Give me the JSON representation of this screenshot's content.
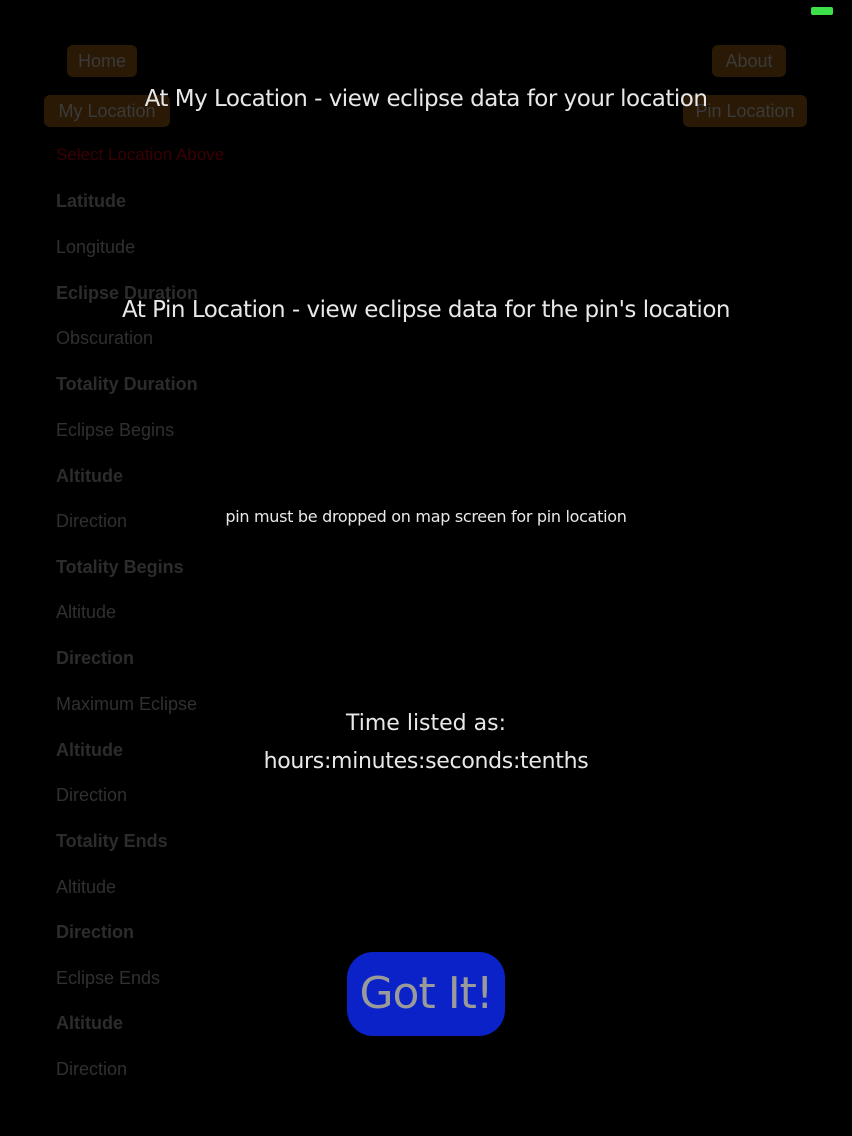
{
  "status_bar": {
    "battery_color": "#3ee04a"
  },
  "nav": {
    "home_label": "Home",
    "about_label": "About",
    "my_location_label": "My Location",
    "pin_location_label": "Pin Location"
  },
  "list": {
    "select_prompt": "Select Location Above",
    "items": [
      "Latitude",
      "Longitude",
      "Eclipse Duration",
      "Obscuration",
      "Totality Duration",
      "Eclipse Begins",
      "Altitude",
      "Direction",
      "Totality Begins",
      "Altitude",
      "Direction",
      "Maximum Eclipse",
      "Altitude",
      "Direction",
      "Totality Ends",
      "Altitude",
      "Direction",
      "Eclipse Ends",
      "Altitude",
      "Direction"
    ]
  },
  "overlay": {
    "my_location_help": "At My Location - view eclipse data for your location",
    "pin_location_help": "At Pin Location - view eclipse data for the pin's location",
    "pin_note": "pin must be dropped on map screen for pin location",
    "time_line1": "Time listed as:",
    "time_line2": "hours:minutes:seconds:tenths",
    "got_it_label": "Got It!"
  },
  "colors": {
    "background": "#000000",
    "button_bg": "#2a1a05",
    "got_it_bg": "#0a22c8",
    "overlay_text": "#e8e8e8"
  }
}
